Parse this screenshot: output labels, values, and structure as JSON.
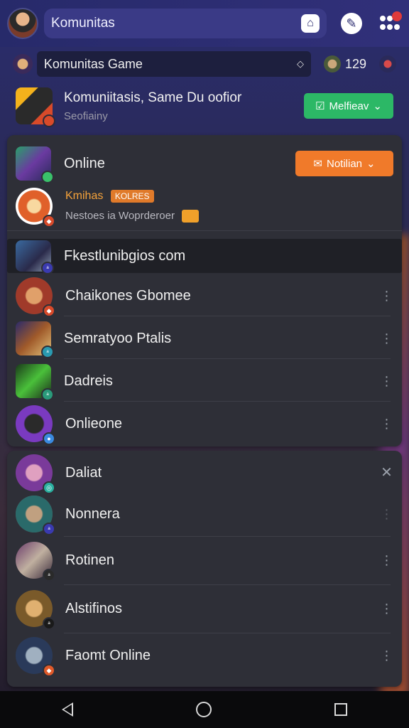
{
  "topbar": {
    "search_title": "Komunitas"
  },
  "subbar": {
    "label": "Komunitas Game",
    "count": "129"
  },
  "community": {
    "title": "Komuniitasis, Same Du oofior",
    "subtitle": "Seofiainy",
    "action_label": "Melfieav"
  },
  "panel1": {
    "online_label": "Online",
    "notify_label": "Notilian",
    "featured": {
      "title": "Kmihas",
      "tag": "KOLRES",
      "subtitle": "Nestoes ia Woprderoer"
    },
    "items": [
      {
        "name": "Fkestlunibgios com"
      },
      {
        "name": "Chaikones Gbomee"
      },
      {
        "name": "Semratyoo Ptalis"
      },
      {
        "name": "Dadreis"
      },
      {
        "name": "Onlieone"
      }
    ]
  },
  "panel2": {
    "items": [
      {
        "name": "Daliat"
      },
      {
        "name": "Nonnera"
      },
      {
        "name": "Rotinen"
      },
      {
        "name": "Alstifinos"
      },
      {
        "name": "Faomt Online"
      }
    ]
  },
  "colors": {
    "accent_green": "#2cb866",
    "accent_orange": "#f07a2a",
    "top_bar": "#2b2c70"
  }
}
